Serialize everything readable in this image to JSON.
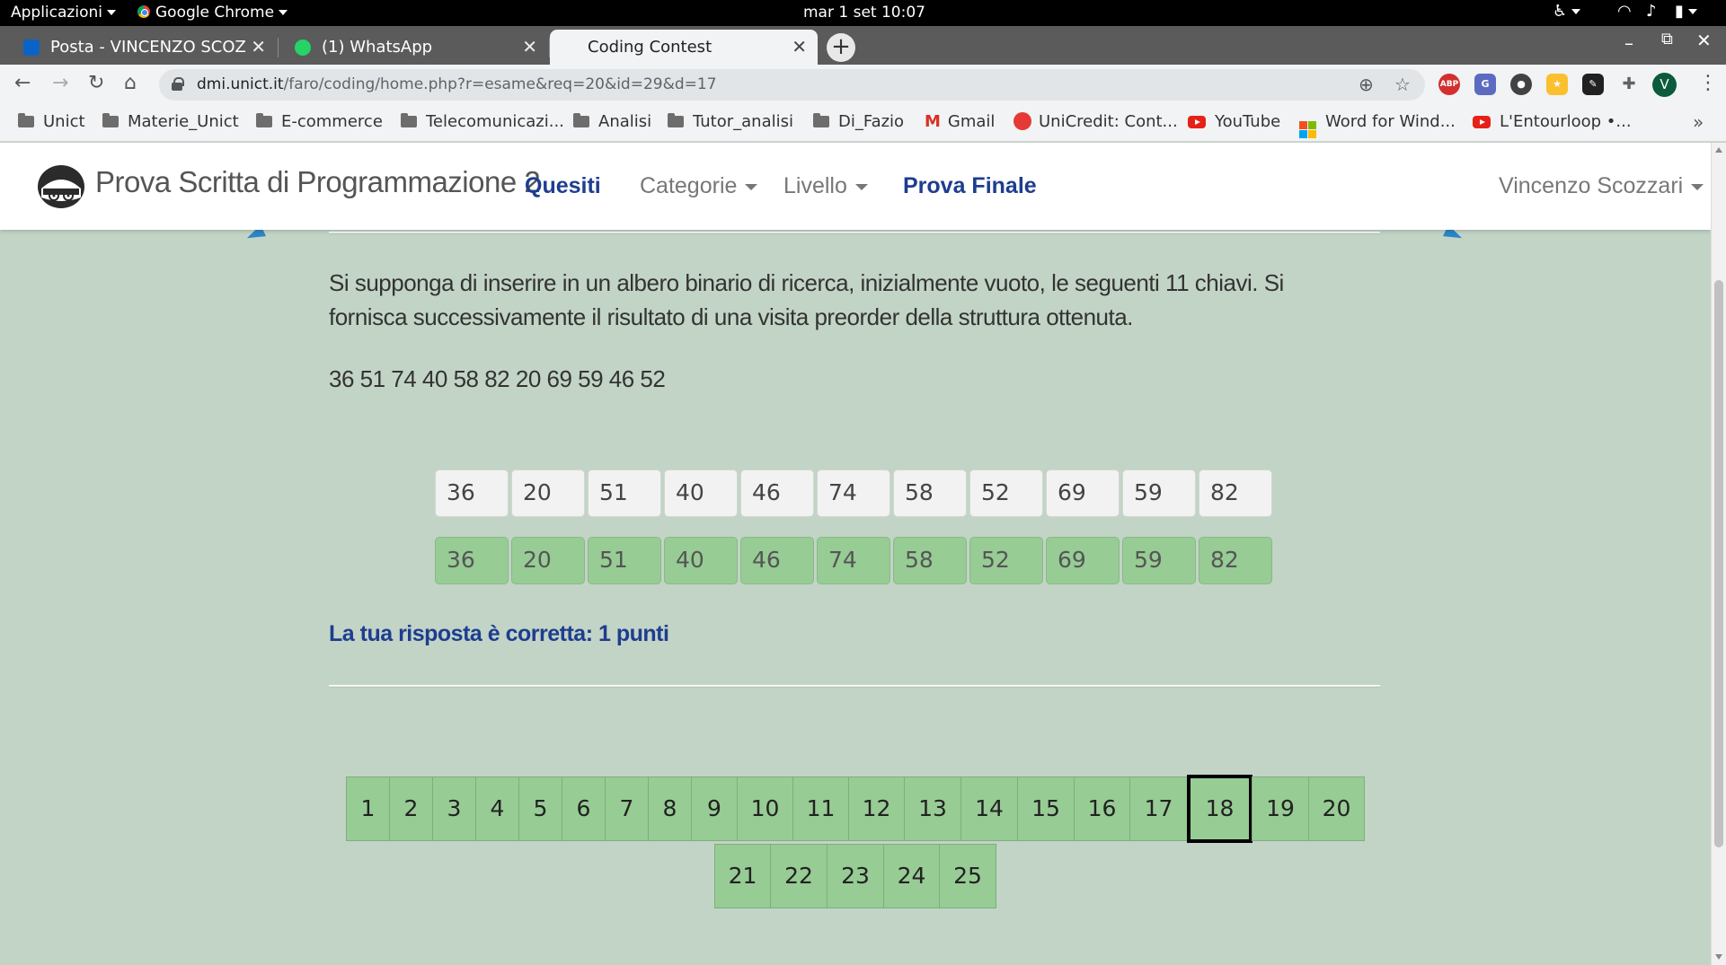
{
  "os": {
    "menu_apps": "Applicazioni",
    "menu_browser": "Google Chrome",
    "clock": "mar 1 set  10:07"
  },
  "tabs": [
    {
      "title": "Posta - VINCENZO SCOZ",
      "favicon_color": "#0a64c8",
      "active": false
    },
    {
      "title": "(1) WhatsApp",
      "favicon_color": "#25d366",
      "active": false
    },
    {
      "title": "Coding Contest",
      "favicon_color": "",
      "active": true
    }
  ],
  "address": {
    "host": "dmi.unict.it",
    "path": "/faro/coding/home.php?r=esame&req=20&id=29&d=17"
  },
  "extensions": [
    {
      "name": "adblock-plus-icon",
      "label": "ABP",
      "color": "#d32f2f"
    },
    {
      "name": "translate-icon",
      "label": "G",
      "color": "#5c6bc0"
    },
    {
      "name": "extension-icon-3",
      "label": "●",
      "color": "#424242"
    },
    {
      "name": "extension-icon-4",
      "label": "★",
      "color": "#fbc02d"
    },
    {
      "name": "extension-icon-5",
      "label": "✎",
      "color": "#212121"
    },
    {
      "name": "puzzle-icon",
      "label": "✚",
      "color": "#5f6368"
    }
  ],
  "profile_initial": "V",
  "bookmarks": [
    {
      "label": "Unict",
      "type": "folder"
    },
    {
      "label": "Materie_Unict",
      "type": "folder"
    },
    {
      "label": "E-commerce",
      "type": "folder"
    },
    {
      "label": "Telecomunicazi...",
      "type": "folder"
    },
    {
      "label": "Analisi",
      "type": "folder"
    },
    {
      "label": "Tutor_analisi",
      "type": "folder"
    },
    {
      "label": "Di_Fazio",
      "type": "folder"
    },
    {
      "label": "Gmail",
      "type": "gmail"
    },
    {
      "label": "UniCredit: Cont...",
      "type": "unicredit"
    },
    {
      "label": "YouTube",
      "type": "youtube"
    },
    {
      "label": "Word for Wind...",
      "type": "microsoft"
    },
    {
      "label": "L'Entourloop •...",
      "type": "youtube"
    }
  ],
  "site": {
    "brand": "Prova Scritta di Programmazione 2",
    "nav": {
      "quesiti": "Quesiti",
      "categorie": "Categorie",
      "livello": "Livello",
      "prova_finale": "Prova Finale",
      "user": "Vincenzo Scozzari"
    }
  },
  "question": {
    "text": "Si supponga di inserire in un albero binario di ricerca, inizialmente vuoto, le seguenti 11 chiavi. Si fornisca successivamente il risultato di una visita preorder della struttura ottenuta.",
    "keys": "36 51 74 40 58 82 20 69 59 46 52",
    "user_answer": [
      "36",
      "20",
      "51",
      "40",
      "46",
      "74",
      "58",
      "52",
      "69",
      "59",
      "82"
    ],
    "correct_answer": [
      "36",
      "20",
      "51",
      "40",
      "46",
      "74",
      "58",
      "52",
      "69",
      "59",
      "82"
    ],
    "feedback": "La tua risposta è corretta: 1 punti"
  },
  "pagination": {
    "pages": [
      "1",
      "2",
      "3",
      "4",
      "5",
      "6",
      "7",
      "8",
      "9",
      "10",
      "11",
      "12",
      "13",
      "14",
      "15",
      "16",
      "17",
      "18",
      "19",
      "20",
      "21",
      "22",
      "23",
      "24",
      "25"
    ],
    "current": "18"
  },
  "colors": {
    "page_bg": "#c2d4c6",
    "correct_green": "#97cc95",
    "link_blue": "#1e3d8f"
  }
}
